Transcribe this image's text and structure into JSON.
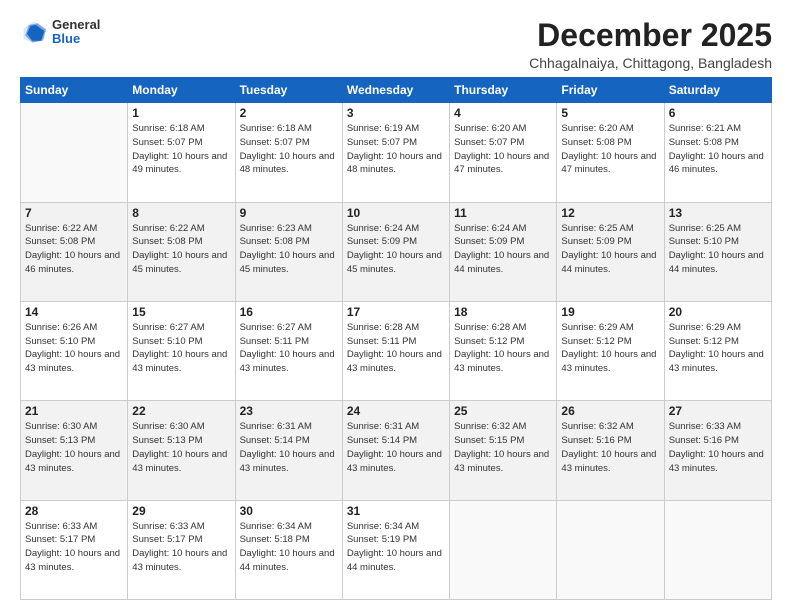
{
  "logo": {
    "general": "General",
    "blue": "Blue"
  },
  "header": {
    "month": "December 2025",
    "location": "Chhagalnaiya, Chittagong, Bangladesh"
  },
  "weekdays": [
    "Sunday",
    "Monday",
    "Tuesday",
    "Wednesday",
    "Thursday",
    "Friday",
    "Saturday"
  ],
  "weeks": [
    [
      {
        "day": "",
        "info": ""
      },
      {
        "day": "1",
        "info": "Sunrise: 6:18 AM\nSunset: 5:07 PM\nDaylight: 10 hours\nand 49 minutes."
      },
      {
        "day": "2",
        "info": "Sunrise: 6:18 AM\nSunset: 5:07 PM\nDaylight: 10 hours\nand 48 minutes."
      },
      {
        "day": "3",
        "info": "Sunrise: 6:19 AM\nSunset: 5:07 PM\nDaylight: 10 hours\nand 48 minutes."
      },
      {
        "day": "4",
        "info": "Sunrise: 6:20 AM\nSunset: 5:07 PM\nDaylight: 10 hours\nand 47 minutes."
      },
      {
        "day": "5",
        "info": "Sunrise: 6:20 AM\nSunset: 5:08 PM\nDaylight: 10 hours\nand 47 minutes."
      },
      {
        "day": "6",
        "info": "Sunrise: 6:21 AM\nSunset: 5:08 PM\nDaylight: 10 hours\nand 46 minutes."
      }
    ],
    [
      {
        "day": "7",
        "info": "Sunrise: 6:22 AM\nSunset: 5:08 PM\nDaylight: 10 hours\nand 46 minutes."
      },
      {
        "day": "8",
        "info": "Sunrise: 6:22 AM\nSunset: 5:08 PM\nDaylight: 10 hours\nand 45 minutes."
      },
      {
        "day": "9",
        "info": "Sunrise: 6:23 AM\nSunset: 5:08 PM\nDaylight: 10 hours\nand 45 minutes."
      },
      {
        "day": "10",
        "info": "Sunrise: 6:24 AM\nSunset: 5:09 PM\nDaylight: 10 hours\nand 45 minutes."
      },
      {
        "day": "11",
        "info": "Sunrise: 6:24 AM\nSunset: 5:09 PM\nDaylight: 10 hours\nand 44 minutes."
      },
      {
        "day": "12",
        "info": "Sunrise: 6:25 AM\nSunset: 5:09 PM\nDaylight: 10 hours\nand 44 minutes."
      },
      {
        "day": "13",
        "info": "Sunrise: 6:25 AM\nSunset: 5:10 PM\nDaylight: 10 hours\nand 44 minutes."
      }
    ],
    [
      {
        "day": "14",
        "info": "Sunrise: 6:26 AM\nSunset: 5:10 PM\nDaylight: 10 hours\nand 43 minutes."
      },
      {
        "day": "15",
        "info": "Sunrise: 6:27 AM\nSunset: 5:10 PM\nDaylight: 10 hours\nand 43 minutes."
      },
      {
        "day": "16",
        "info": "Sunrise: 6:27 AM\nSunset: 5:11 PM\nDaylight: 10 hours\nand 43 minutes."
      },
      {
        "day": "17",
        "info": "Sunrise: 6:28 AM\nSunset: 5:11 PM\nDaylight: 10 hours\nand 43 minutes."
      },
      {
        "day": "18",
        "info": "Sunrise: 6:28 AM\nSunset: 5:12 PM\nDaylight: 10 hours\nand 43 minutes."
      },
      {
        "day": "19",
        "info": "Sunrise: 6:29 AM\nSunset: 5:12 PM\nDaylight: 10 hours\nand 43 minutes."
      },
      {
        "day": "20",
        "info": "Sunrise: 6:29 AM\nSunset: 5:12 PM\nDaylight: 10 hours\nand 43 minutes."
      }
    ],
    [
      {
        "day": "21",
        "info": "Sunrise: 6:30 AM\nSunset: 5:13 PM\nDaylight: 10 hours\nand 43 minutes."
      },
      {
        "day": "22",
        "info": "Sunrise: 6:30 AM\nSunset: 5:13 PM\nDaylight: 10 hours\nand 43 minutes."
      },
      {
        "day": "23",
        "info": "Sunrise: 6:31 AM\nSunset: 5:14 PM\nDaylight: 10 hours\nand 43 minutes."
      },
      {
        "day": "24",
        "info": "Sunrise: 6:31 AM\nSunset: 5:14 PM\nDaylight: 10 hours\nand 43 minutes."
      },
      {
        "day": "25",
        "info": "Sunrise: 6:32 AM\nSunset: 5:15 PM\nDaylight: 10 hours\nand 43 minutes."
      },
      {
        "day": "26",
        "info": "Sunrise: 6:32 AM\nSunset: 5:16 PM\nDaylight: 10 hours\nand 43 minutes."
      },
      {
        "day": "27",
        "info": "Sunrise: 6:33 AM\nSunset: 5:16 PM\nDaylight: 10 hours\nand 43 minutes."
      }
    ],
    [
      {
        "day": "28",
        "info": "Sunrise: 6:33 AM\nSunset: 5:17 PM\nDaylight: 10 hours\nand 43 minutes."
      },
      {
        "day": "29",
        "info": "Sunrise: 6:33 AM\nSunset: 5:17 PM\nDaylight: 10 hours\nand 43 minutes."
      },
      {
        "day": "30",
        "info": "Sunrise: 6:34 AM\nSunset: 5:18 PM\nDaylight: 10 hours\nand 44 minutes."
      },
      {
        "day": "31",
        "info": "Sunrise: 6:34 AM\nSunset: 5:19 PM\nDaylight: 10 hours\nand 44 minutes."
      },
      {
        "day": "",
        "info": ""
      },
      {
        "day": "",
        "info": ""
      },
      {
        "day": "",
        "info": ""
      }
    ]
  ]
}
